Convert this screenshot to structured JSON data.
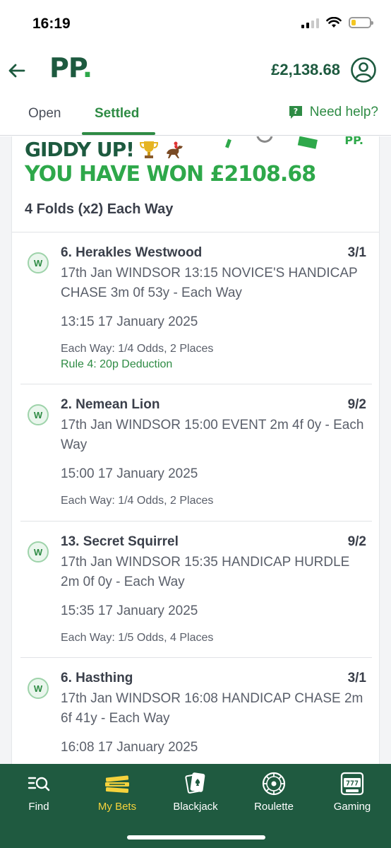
{
  "status_bar": {
    "time": "16:19"
  },
  "header": {
    "logo_text": "PP",
    "logo_dot": ".",
    "balance": "£2,138.68"
  },
  "tabs": {
    "open": "Open",
    "settled": "Settled",
    "help": "Need help?"
  },
  "banner": {
    "line1": "GIDDY UP!",
    "line2": "YOU HAVE WON £2108.68",
    "logo_text": "PP."
  },
  "bet_type": "4 Folds (x2) Each Way",
  "selections": [
    {
      "badge": "W",
      "name": "6. Herakles Westwood",
      "odds": "3/1",
      "description": "17th Jan WINDSOR 13:15 NOVICE'S HANDICAP CHASE 3m 0f 53y - Each Way",
      "time": "13:15 17 January 2025",
      "each_way": "Each Way: 1/4 Odds, 2 Places",
      "rule": "Rule 4: 20p Deduction"
    },
    {
      "badge": "W",
      "name": "2. Nemean Lion",
      "odds": "9/2",
      "description": "17th Jan WINDSOR 15:00 EVENT 2m 4f 0y - Each Way",
      "time": "15:00 17 January 2025",
      "each_way": "Each Way: 1/4 Odds, 2 Places"
    },
    {
      "badge": "W",
      "name": "13. Secret Squirrel",
      "odds": "9/2",
      "description": "17th Jan WINDSOR 15:35 HANDICAP HURDLE 2m 0f 0y - Each Way",
      "time": "15:35 17 January 2025",
      "each_way": "Each Way: 1/5 Odds, 4 Places"
    },
    {
      "badge": "W",
      "name": "6. Hasthing",
      "odds": "3/1",
      "description": "17th Jan WINDSOR 16:08 HANDICAP CHASE 2m 6f 41y - Each Way",
      "time": "16:08 17 January 2025"
    }
  ],
  "bottom_nav": [
    {
      "label": "Find",
      "icon": "find-icon"
    },
    {
      "label": "My Bets",
      "icon": "my-bets-icon"
    },
    {
      "label": "Blackjack",
      "icon": "blackjack-icon"
    },
    {
      "label": "Roulette",
      "icon": "roulette-icon"
    },
    {
      "label": "Gaming",
      "icon": "gaming-icon"
    }
  ],
  "colors": {
    "brand_dark_green": "#1d5a3f",
    "brand_green": "#2e8b44",
    "win_green": "#2ea84a",
    "nav_background": "#1f5a40",
    "nav_active": "#f5d23c"
  }
}
